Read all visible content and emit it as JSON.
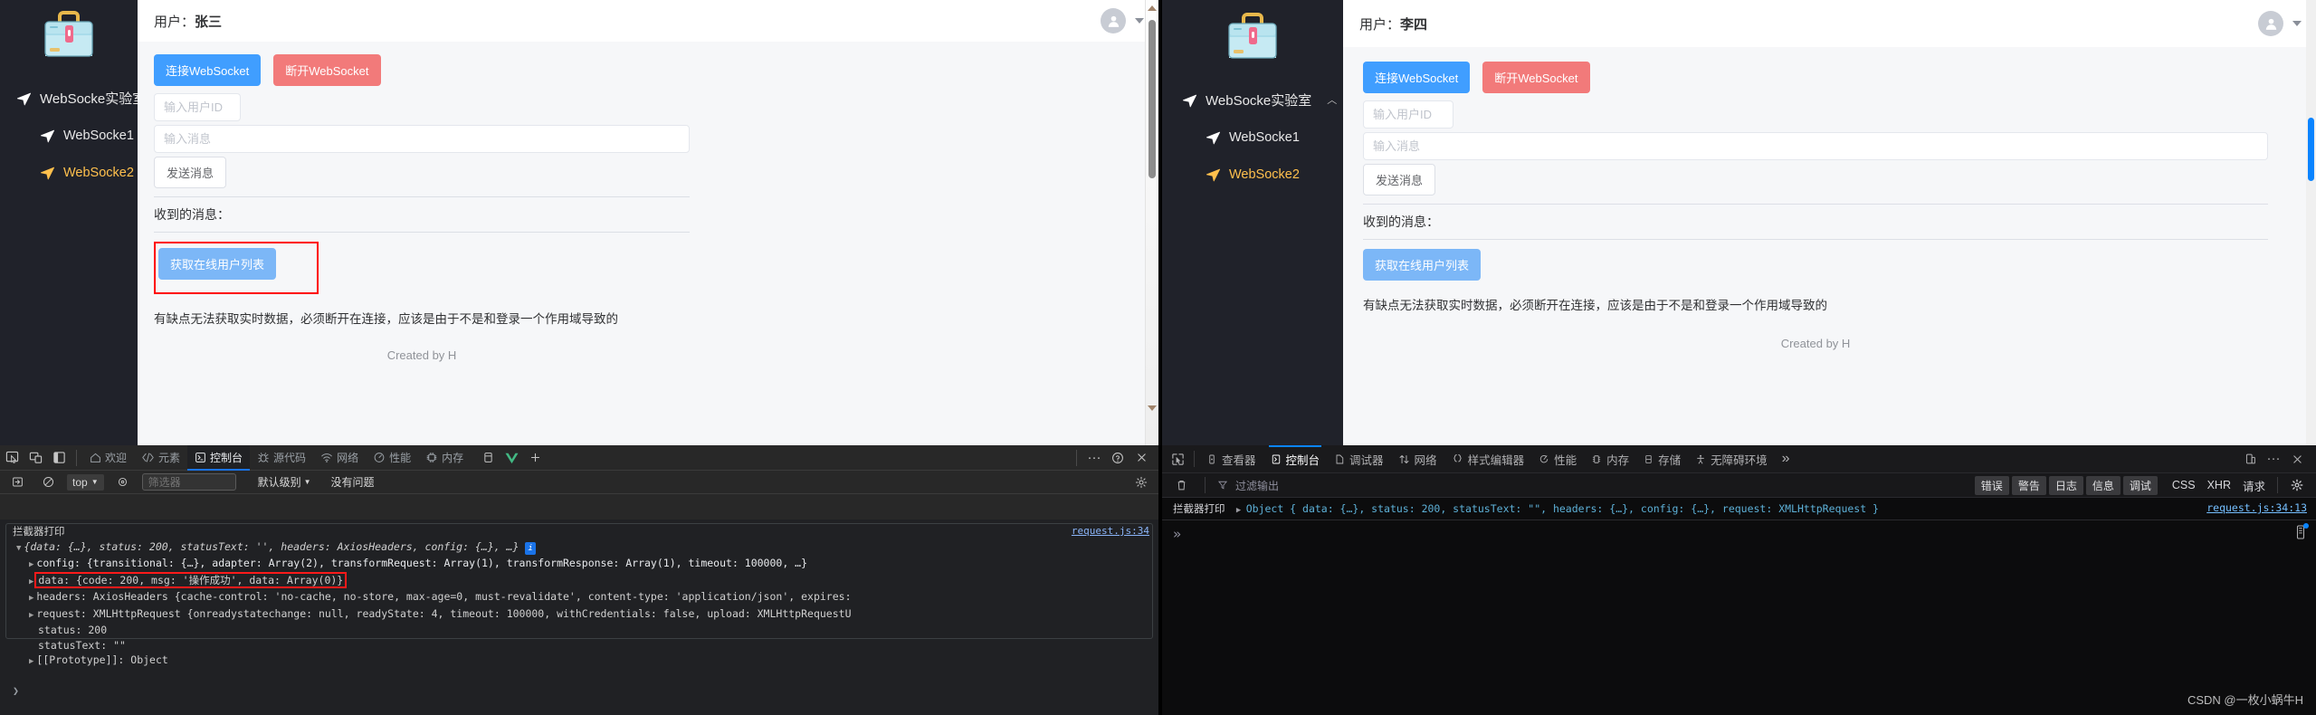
{
  "left_app": {
    "sidebar": {
      "logo_name": "toolbox-logo",
      "group_label": "WebSocke实验室",
      "items": [
        {
          "label": "WebSocke1",
          "active": false
        },
        {
          "label": "WebSocke2",
          "active": true
        }
      ]
    },
    "header": {
      "label_prefix": "用户：",
      "user": "张三"
    },
    "buttons": {
      "connect": "连接WebSocket",
      "disconnect": "断开WebSocket",
      "send": "发送消息",
      "get_online_list": "获取在线用户列表"
    },
    "inputs": {
      "user_id_placeholder": "输入用户ID",
      "message_placeholder": "输入消息"
    },
    "received_label": "收到的消息：",
    "note": "有缺点无法获取实时数据，必须断开在连接，应该是由于不是和登录一个作用域导致的",
    "footer": "Created by H"
  },
  "right_app": {
    "sidebar": {
      "group_label": "WebSocke实验室",
      "items": [
        {
          "label": "WebSocke1",
          "active": false
        },
        {
          "label": "WebSocke2",
          "active": true
        }
      ]
    },
    "header": {
      "label_prefix": "用户：",
      "user": "李四"
    },
    "buttons": {
      "connect": "连接WebSocket",
      "disconnect": "断开WebSocket",
      "send": "发送消息",
      "get_online_list": "获取在线用户列表"
    },
    "inputs": {
      "user_id_placeholder": "输入用户ID",
      "message_placeholder": "输入消息"
    },
    "received_label": "收到的消息：",
    "note": "有缺点无法获取实时数据，必须断开在连接，应该是由于不是和登录一个作用域导致的",
    "footer": "Created by H"
  },
  "chrome_devtools": {
    "tabs": [
      {
        "label": "欢迎",
        "icon": "home-icon",
        "selected": false
      },
      {
        "label": "元素",
        "icon": "code-icon",
        "selected": false
      },
      {
        "label": "控制台",
        "icon": "console-icon",
        "selected": true
      },
      {
        "label": "源代码",
        "icon": "bug-icon",
        "selected": false
      },
      {
        "label": "网络",
        "icon": "network-icon",
        "selected": false
      },
      {
        "label": "性能",
        "icon": "performance-icon",
        "selected": false
      },
      {
        "label": "内存",
        "icon": "memory-icon",
        "selected": false
      }
    ],
    "more_label": "···",
    "filter_bar": {
      "context": "top",
      "filter_placeholder": "筛选器",
      "level": "默认级别",
      "issues": "没有问题"
    },
    "console": {
      "source_link": "request.js:34",
      "line1_label": "拦截器打印",
      "line2": "{data: {…}, status: 200, statusText: '', headers: AxiosHeaders, config: {…}, …}",
      "rows": [
        "config: {transitional: {…}, adapter: Array(2), transformRequest: Array(1), transformResponse: Array(1), timeout: 100000, …}",
        "data: {code: 200, msg: '操作成功', data: Array(0)}",
        "headers: AxiosHeaders {cache-control: 'no-cache, no-store, max-age=0, must-revalidate', content-type: 'application/json', expires:",
        "request: XMLHttpRequest {onreadystatechange: null, readyState: 4, timeout: 100000, withCredentials: false, upload: XMLHttpRequestU",
        "status: 200",
        "statusText: \"\"",
        "[[Prototype]]: Object"
      ],
      "prompt": "❯"
    }
  },
  "firefox_devtools": {
    "tabs": [
      {
        "label": "查看器",
        "selected": false
      },
      {
        "label": "控制台",
        "selected": true
      },
      {
        "label": "调试器",
        "selected": false
      },
      {
        "label": "网络",
        "selected": false
      },
      {
        "label": "样式编辑器",
        "selected": false
      },
      {
        "label": "性能",
        "selected": false
      },
      {
        "label": "内存",
        "selected": false
      },
      {
        "label": "存储",
        "selected": false
      },
      {
        "label": "无障碍环境",
        "selected": false
      }
    ],
    "overflow_label": "»",
    "filter_bar": {
      "filter_placeholder": "过滤输出",
      "pills": [
        "错误",
        "警告",
        "日志",
        "信息",
        "调试"
      ],
      "plain": [
        "CSS",
        "XHR",
        "请求"
      ]
    },
    "console": {
      "label": "拦截器打印",
      "object": "Object { data: {…}, status: 200, statusText: \"\", headers: {…}, config: {…}, request: XMLHttpRequest }",
      "source_link": "request.js:34:13",
      "prompt": "»"
    }
  },
  "watermark": "CSDN @一枚小蜗牛H",
  "colors": {
    "accent_blue": "#409eff",
    "danger_red": "#f27a7a",
    "highlight_red": "#ff0000",
    "sidebar_bg": "#20222a",
    "active_item": "#ffc04d"
  }
}
